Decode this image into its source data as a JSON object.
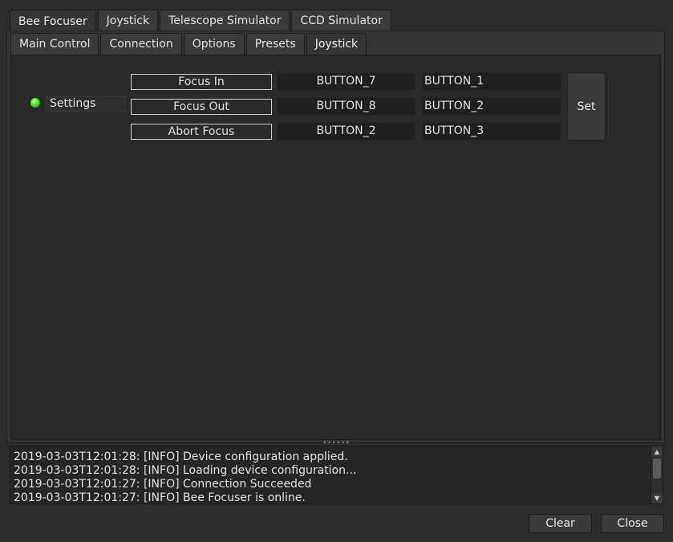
{
  "top_tabs": [
    {
      "label": "Bee Focuser",
      "active": true
    },
    {
      "label": "Joystick",
      "active": false
    },
    {
      "label": "Telescope Simulator",
      "active": false
    },
    {
      "label": "CCD Simulator",
      "active": false
    }
  ],
  "sub_tabs": [
    {
      "label": "Main Control",
      "active": false
    },
    {
      "label": "Connection",
      "active": false
    },
    {
      "label": "Options",
      "active": false
    },
    {
      "label": "Presets",
      "active": false
    },
    {
      "label": "Joystick",
      "active": true
    }
  ],
  "settings": {
    "label": "Settings",
    "status_color": "#4ee02a",
    "rows": [
      {
        "action": "Focus In",
        "value1": "BUTTON_7",
        "value2": "BUTTON_1"
      },
      {
        "action": "Focus Out",
        "value1": "BUTTON_8",
        "value2": "BUTTON_2"
      },
      {
        "action": "Abort Focus",
        "value1": "BUTTON_2",
        "value2": "BUTTON_3"
      }
    ],
    "set_label": "Set"
  },
  "log": {
    "lines": [
      "2019-03-03T12:01:28: [INFO] Device configuration applied.",
      "2019-03-03T12:01:28: [INFO] Loading device configuration...",
      "2019-03-03T12:01:27: [INFO] Connection Succeeded",
      "2019-03-03T12:01:27: [INFO] Bee Focuser is online."
    ]
  },
  "buttons": {
    "clear_label": "Clear",
    "close_label": "Close"
  }
}
